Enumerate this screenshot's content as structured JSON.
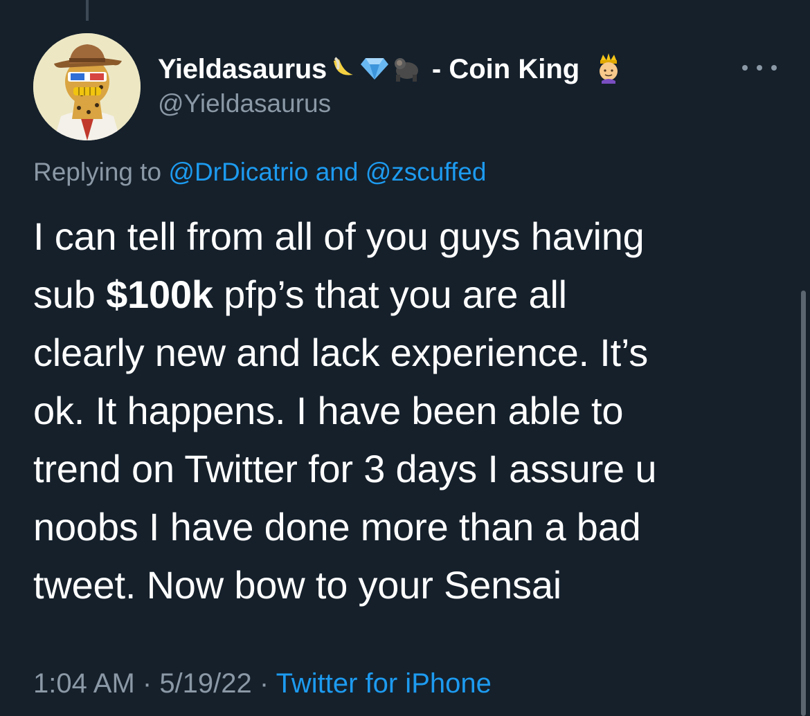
{
  "author": {
    "display_name": "Yieldasaurus",
    "name_suffix": "- Coin King",
    "handle": "@Yieldasaurus",
    "emojis": [
      "banana-emoji",
      "gem-emoji",
      "gorilla-emoji",
      "prince-emoji"
    ]
  },
  "reply": {
    "prefix": "Replying to",
    "mention_1": "@DrDicatrio",
    "connector": "and",
    "mention_2": "@zscuffed"
  },
  "tweet": {
    "line1": "I can tell from all of you guys having",
    "line2_a": "sub ",
    "line2_bold": "$100k",
    "line2_b": " pfp’s that you are all",
    "line3": "clearly new and lack experience. It’s",
    "line4": "ok. It happens. I have been able to",
    "line5": "trend on Twitter for 3 days I assure u",
    "line6": "noobs I have done more than a bad",
    "line7": "tweet. Now bow to your Sensai"
  },
  "meta": {
    "time": "1:04 AM",
    "separator": " · ",
    "date": "5/19/22",
    "source": "Twitter for iPhone"
  },
  "colors": {
    "background": "#15202b",
    "text_primary": "#ffffff",
    "text_secondary": "#8b98a5",
    "accent_link": "#1d9bf0"
  },
  "icons": {
    "more": "more-horizontal-icon"
  }
}
